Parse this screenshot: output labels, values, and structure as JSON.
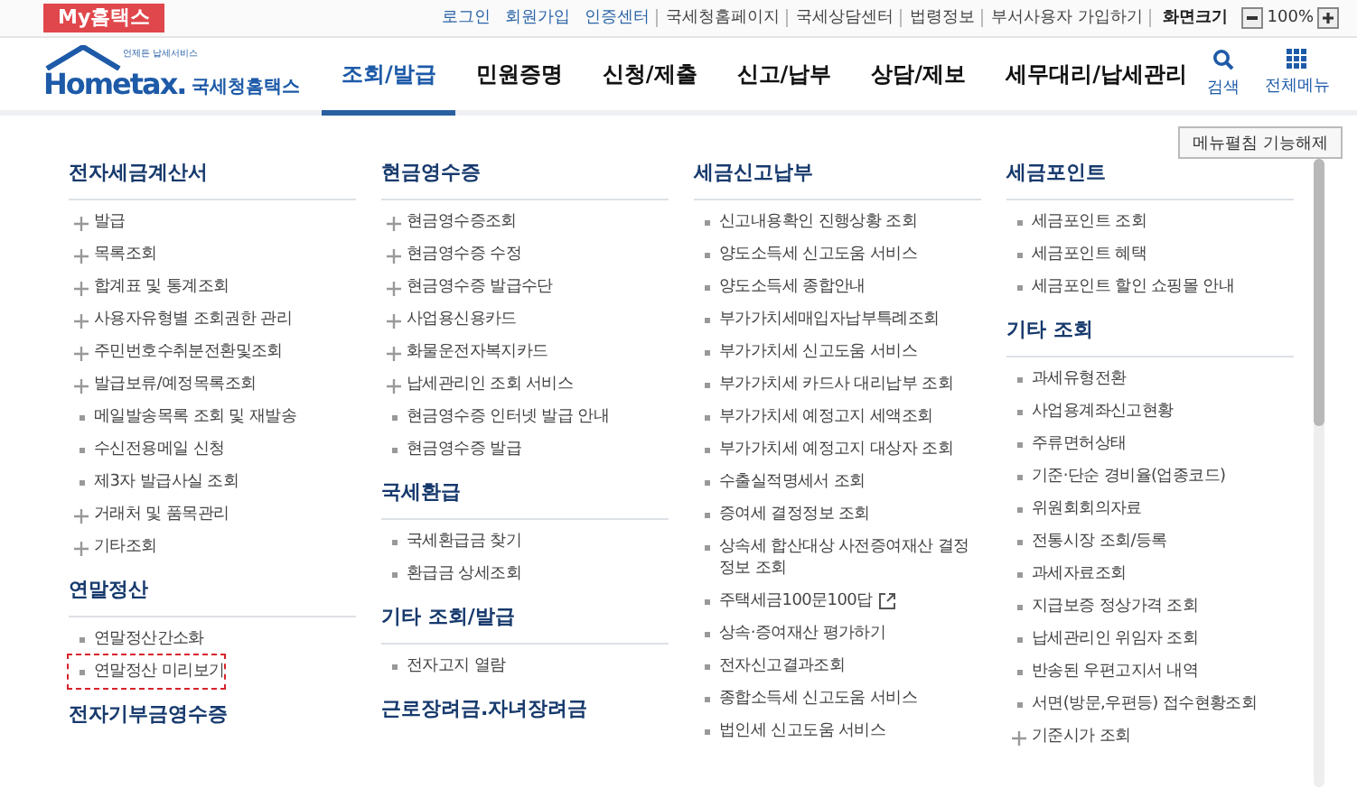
{
  "top_bar": {
    "my_button": "My홈택스",
    "links": [
      {
        "label": "로그인",
        "kind": "account"
      },
      {
        "label": "회원가입",
        "kind": "account"
      },
      {
        "label": "인증센터",
        "kind": "account"
      },
      {
        "label": "국세청홈페이지",
        "kind": "plain"
      },
      {
        "label": "국세상담센터",
        "kind": "plain"
      },
      {
        "label": "법령정보",
        "kind": "plain"
      },
      {
        "label": "부서사용자 가입하기",
        "kind": "plain"
      }
    ],
    "zoom": {
      "label": "화면크기",
      "value": "100%"
    }
  },
  "header": {
    "logo": {
      "tagline": "언제든 납세서비스",
      "wordmark": "Hometax.",
      "name": "국세청홈택스"
    },
    "nav": [
      {
        "label": "조회/발급",
        "selected": true
      },
      {
        "label": "민원증명",
        "selected": false
      },
      {
        "label": "신청/제출",
        "selected": false
      },
      {
        "label": "신고/납부",
        "selected": false
      },
      {
        "label": "상담/제보",
        "selected": false
      },
      {
        "label": "세무대리/납세관리",
        "selected": false
      }
    ],
    "tools": [
      {
        "label": "검색",
        "kind": "search"
      },
      {
        "label": "전체메뉴",
        "kind": "grid"
      }
    ]
  },
  "menu_toggle": "메뉴펼침 기능해제",
  "columns": [
    [
      {
        "title": "전자세금계산서",
        "items": [
          {
            "label": "발급",
            "kind": "expandable"
          },
          {
            "label": "목록조회",
            "kind": "expandable"
          },
          {
            "label": "합계표 및 통계조회",
            "kind": "expandable"
          },
          {
            "label": "사용자유형별 조회권한 관리",
            "kind": "expandable"
          },
          {
            "label": "주민번호수취분전환및조회",
            "kind": "expandable"
          },
          {
            "label": "발급보류/예정목록조회",
            "kind": "expandable"
          },
          {
            "label": "메일발송목록 조회 및 재발송",
            "kind": "link"
          },
          {
            "label": "수신전용메일 신청",
            "kind": "link"
          },
          {
            "label": "제3자 발급사실 조회",
            "kind": "link"
          },
          {
            "label": "거래처 및 품목관리",
            "kind": "expandable"
          },
          {
            "label": "기타조회",
            "kind": "expandable"
          }
        ]
      },
      {
        "title": "연말정산",
        "items": [
          {
            "label": "연말정산간소화",
            "kind": "link",
            "highlighted": false
          },
          {
            "label": "연말정산 미리보기",
            "kind": "link",
            "highlighted": true
          }
        ]
      },
      {
        "title": "전자기부금영수증"
      }
    ],
    [
      {
        "title": "현금영수증",
        "items": [
          {
            "label": "현금영수증조회",
            "kind": "expandable"
          },
          {
            "label": "현금영수증 수정",
            "kind": "expandable"
          },
          {
            "label": "현금영수증 발급수단",
            "kind": "expandable"
          },
          {
            "label": "사업용신용카드",
            "kind": "expandable"
          },
          {
            "label": "화물운전자복지카드",
            "kind": "expandable"
          },
          {
            "label": "납세관리인 조회 서비스",
            "kind": "expandable"
          },
          {
            "label": "현금영수증 인터넷 발급 안내",
            "kind": "link"
          },
          {
            "label": "현금영수증 발급",
            "kind": "link"
          }
        ]
      },
      {
        "title": "국세환급",
        "items": [
          {
            "label": "국세환급금 찾기",
            "kind": "link"
          },
          {
            "label": "환급금 상세조회",
            "kind": "link"
          }
        ]
      },
      {
        "title": "기타 조회/발급",
        "items": [
          {
            "label": "전자고지 열람",
            "kind": "link"
          }
        ]
      },
      {
        "title": "근로장려금.자녀장려금"
      }
    ],
    [
      {
        "title": "세금신고납부",
        "items": [
          {
            "label": "신고내용확인 진행상황 조회",
            "kind": "link"
          },
          {
            "label": "양도소득세 신고도움 서비스",
            "kind": "link"
          },
          {
            "label": "양도소득세 종합안내",
            "kind": "link"
          },
          {
            "label": "부가가치세매입자납부특례조회",
            "kind": "link"
          },
          {
            "label": "부가가치세 신고도움 서비스",
            "kind": "link"
          },
          {
            "label": "부가가치세 카드사 대리납부 조회",
            "kind": "link"
          },
          {
            "label": "부가가치세 예정고지 세액조회",
            "kind": "link"
          },
          {
            "label": "부가가치세 예정고지 대상자 조회",
            "kind": "link"
          },
          {
            "label": "수출실적명세서 조회",
            "kind": "link"
          },
          {
            "label": "증여세 결정정보 조회",
            "kind": "link"
          },
          {
            "label": "상속세 합산대상 사전증여재산 결정정보 조회",
            "kind": "link"
          },
          {
            "label": "주택세금100문100답",
            "kind": "external"
          },
          {
            "label": "상속·증여재산 평가하기",
            "kind": "link"
          },
          {
            "label": "전자신고결과조회",
            "kind": "link"
          },
          {
            "label": "종합소득세 신고도움 서비스",
            "kind": "link"
          },
          {
            "label": "법인세 신고도움 서비스",
            "kind": "link"
          }
        ]
      }
    ],
    [
      {
        "title": "세금포인트",
        "items": [
          {
            "label": "세금포인트 조회",
            "kind": "link"
          },
          {
            "label": "세금포인트 혜택",
            "kind": "link"
          },
          {
            "label": "세금포인트 할인 쇼핑몰 안내",
            "kind": "link"
          }
        ]
      },
      {
        "title": "기타 조회",
        "items": [
          {
            "label": "과세유형전환",
            "kind": "link"
          },
          {
            "label": "사업용계좌신고현황",
            "kind": "link"
          },
          {
            "label": "주류면허상태",
            "kind": "link"
          },
          {
            "label": "기준·단순 경비율(업종코드)",
            "kind": "link"
          },
          {
            "label": "위원회회의자료",
            "kind": "link"
          },
          {
            "label": "전통시장 조회/등록",
            "kind": "link"
          },
          {
            "label": "과세자료조회",
            "kind": "link"
          },
          {
            "label": "지급보증 정상가격 조회",
            "kind": "link"
          },
          {
            "label": "납세관리인 위임자 조회",
            "kind": "link"
          },
          {
            "label": "반송된 우편고지서 내역",
            "kind": "link"
          },
          {
            "label": "서면(방문,우편등) 접수현황조회",
            "kind": "link"
          },
          {
            "label": "기준시가 조회",
            "kind": "expandable"
          }
        ]
      }
    ]
  ]
}
